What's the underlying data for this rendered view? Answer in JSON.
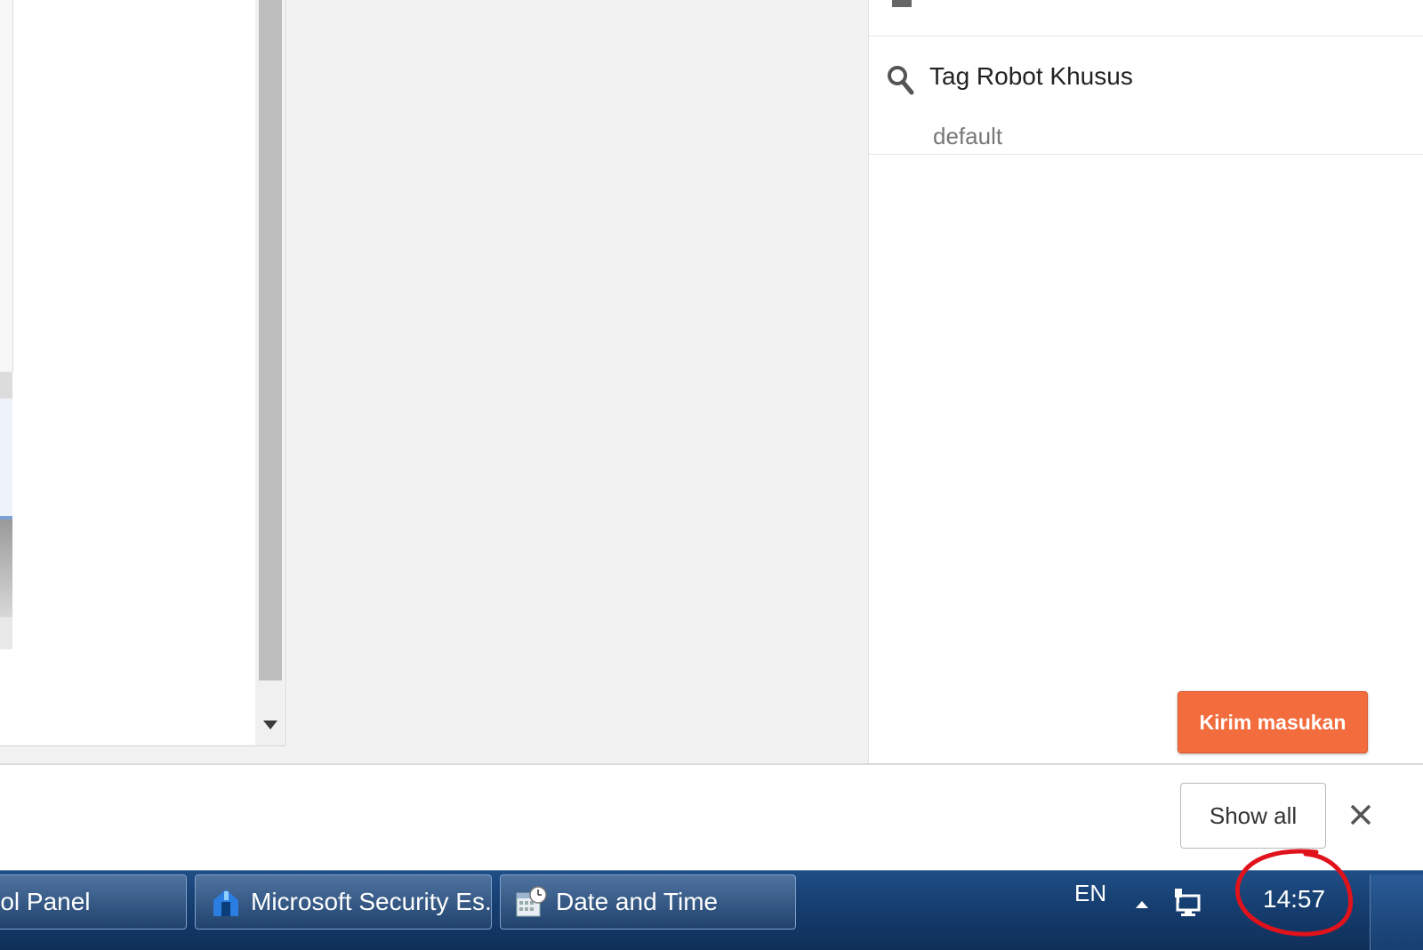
{
  "right_panel": {
    "row_title": "Tag Robot Khusus",
    "row_value": "default",
    "feedback_button": "Kirim masukan"
  },
  "download_bar": {
    "show_all": "Show all"
  },
  "taskbar": {
    "items": [
      {
        "label": "rol Panel"
      },
      {
        "label": "Microsoft Security Es..."
      },
      {
        "label": "Date and Time"
      }
    ],
    "language": "EN",
    "clock": "14:57"
  },
  "colors": {
    "feedback_button": "#f26c3d",
    "annotation_circle": "#e0121b",
    "taskbar": "#163e70"
  }
}
